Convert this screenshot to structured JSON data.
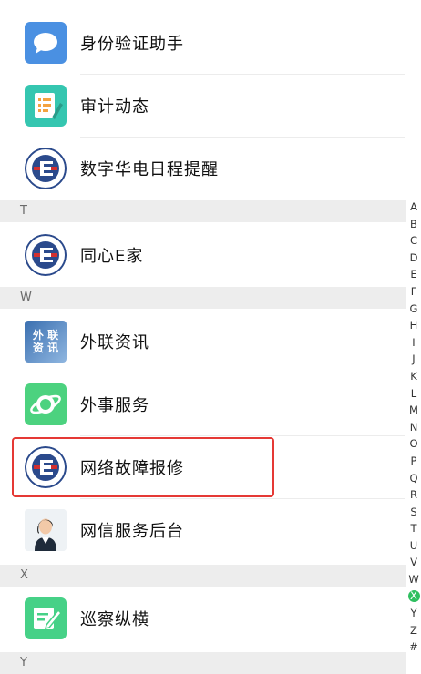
{
  "items": {
    "id_verify": {
      "label": "身份验证助手",
      "icon": "chat-bubble-icon",
      "color": "#4a90e2"
    },
    "audit": {
      "label": "审计动态",
      "icon": "document-edit-icon",
      "color": "#35c6b0"
    },
    "digital_reminder": {
      "label": "数字华电日程提醒",
      "icon": "company-logo-icon",
      "color": "#cc2a2a"
    },
    "tongxin": {
      "label": "同心E家",
      "icon": "company-logo-icon",
      "color": "#cc2a2a"
    },
    "foreign_news": {
      "label": "外联资讯",
      "icon": "foreign-news-icon",
      "color": "#3a6fb0",
      "icon_text_1": "外 联",
      "icon_text_2": "资 讯"
    },
    "foreign_service": {
      "label": "外事服务",
      "icon": "planet-icon",
      "color": "#4cd27f"
    },
    "network_repair": {
      "label": "网络故障报修",
      "icon": "company-logo-icon",
      "color": "#cc2a2a"
    },
    "network_backend": {
      "label": "网信服务后台",
      "icon": "customer-service-avatar",
      "color": "#e0e0e0"
    },
    "patrol": {
      "label": "巡察纵横",
      "icon": "note-edit-icon",
      "color": "#46d187"
    }
  },
  "sections": {
    "t": "T",
    "w": "W",
    "x": "X",
    "y": "Y"
  },
  "index_letters": [
    "A",
    "B",
    "C",
    "D",
    "E",
    "F",
    "G",
    "H",
    "I",
    "J",
    "K",
    "L",
    "M",
    "N",
    "O",
    "P",
    "Q",
    "R",
    "S",
    "T",
    "U",
    "V",
    "W",
    "X",
    "Y",
    "Z",
    "#"
  ],
  "index_active": "X",
  "highlight_color": "#e53935"
}
